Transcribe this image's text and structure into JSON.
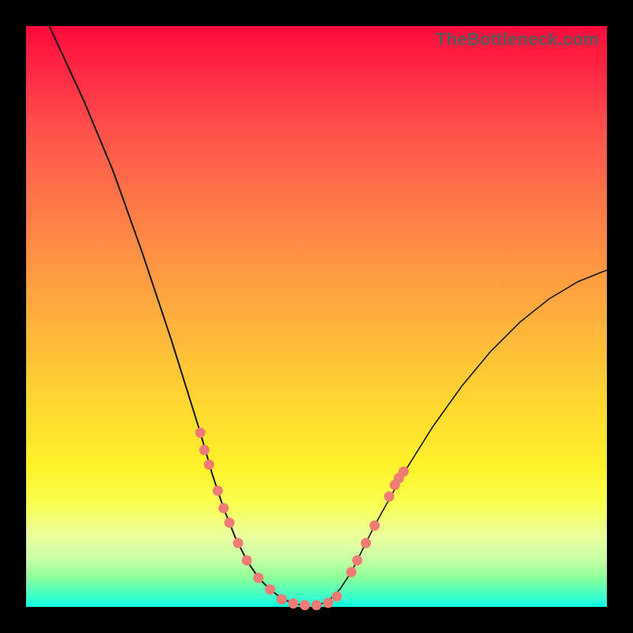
{
  "watermark": "TheBottleneck.com",
  "colors": {
    "frame": "#000000",
    "curve": "#1a1a1a",
    "dot": "#ee7c74"
  },
  "chart_data": {
    "type": "line",
    "title": "",
    "xlabel": "",
    "ylabel": "",
    "xlim": [
      0,
      100
    ],
    "ylim": [
      0,
      100
    ],
    "grid": false,
    "legend": null,
    "series": [
      {
        "name": "left-curve",
        "x": [
          4,
          10,
          15,
          20,
          25,
          30,
          32,
          34,
          36,
          38,
          40,
          42,
          44,
          46,
          48
        ],
        "y": [
          100,
          87,
          75,
          61,
          46,
          30,
          23,
          17,
          12,
          8,
          5,
          3,
          1.5,
          0.6,
          0.2
        ]
      },
      {
        "name": "right-curve",
        "x": [
          50,
          52,
          54,
          56,
          58,
          60,
          65,
          70,
          75,
          80,
          85,
          90,
          95,
          100
        ],
        "y": [
          0.2,
          1,
          3,
          6,
          10,
          14,
          23,
          31,
          38,
          44,
          49,
          53,
          56,
          58
        ]
      }
    ],
    "markers": [
      {
        "series": "left-cluster",
        "x": 30.0,
        "y": 30
      },
      {
        "series": "left-cluster",
        "x": 30.7,
        "y": 27
      },
      {
        "series": "left-cluster",
        "x": 31.5,
        "y": 24.5
      },
      {
        "series": "left-cluster",
        "x": 33.0,
        "y": 20
      },
      {
        "series": "left-cluster",
        "x": 34.0,
        "y": 17
      },
      {
        "series": "left-cluster",
        "x": 35.0,
        "y": 14.5
      },
      {
        "series": "left-cluster",
        "x": 36.5,
        "y": 11
      },
      {
        "series": "left-cluster",
        "x": 38.0,
        "y": 8
      },
      {
        "series": "left-cluster",
        "x": 40.0,
        "y": 5
      },
      {
        "series": "left-cluster",
        "x": 42.0,
        "y": 3
      },
      {
        "series": "bottom-cluster",
        "x": 44.0,
        "y": 1.3
      },
      {
        "series": "bottom-cluster",
        "x": 46.0,
        "y": 0.6
      },
      {
        "series": "bottom-cluster",
        "x": 48.0,
        "y": 0.3
      },
      {
        "series": "bottom-cluster",
        "x": 50.0,
        "y": 0.3
      },
      {
        "series": "bottom-cluster",
        "x": 52.0,
        "y": 0.7
      },
      {
        "series": "bottom-cluster",
        "x": 53.5,
        "y": 1.8
      },
      {
        "series": "right-cluster",
        "x": 56.0,
        "y": 6
      },
      {
        "series": "right-cluster",
        "x": 57.0,
        "y": 8
      },
      {
        "series": "right-cluster",
        "x": 58.5,
        "y": 11
      },
      {
        "series": "right-cluster",
        "x": 60.0,
        "y": 14
      },
      {
        "series": "right-cluster",
        "x": 62.5,
        "y": 19
      },
      {
        "series": "right-cluster",
        "x": 63.5,
        "y": 21
      },
      {
        "series": "right-cluster",
        "x": 64.2,
        "y": 22.2
      },
      {
        "series": "right-cluster",
        "x": 65.0,
        "y": 23.3
      }
    ]
  }
}
